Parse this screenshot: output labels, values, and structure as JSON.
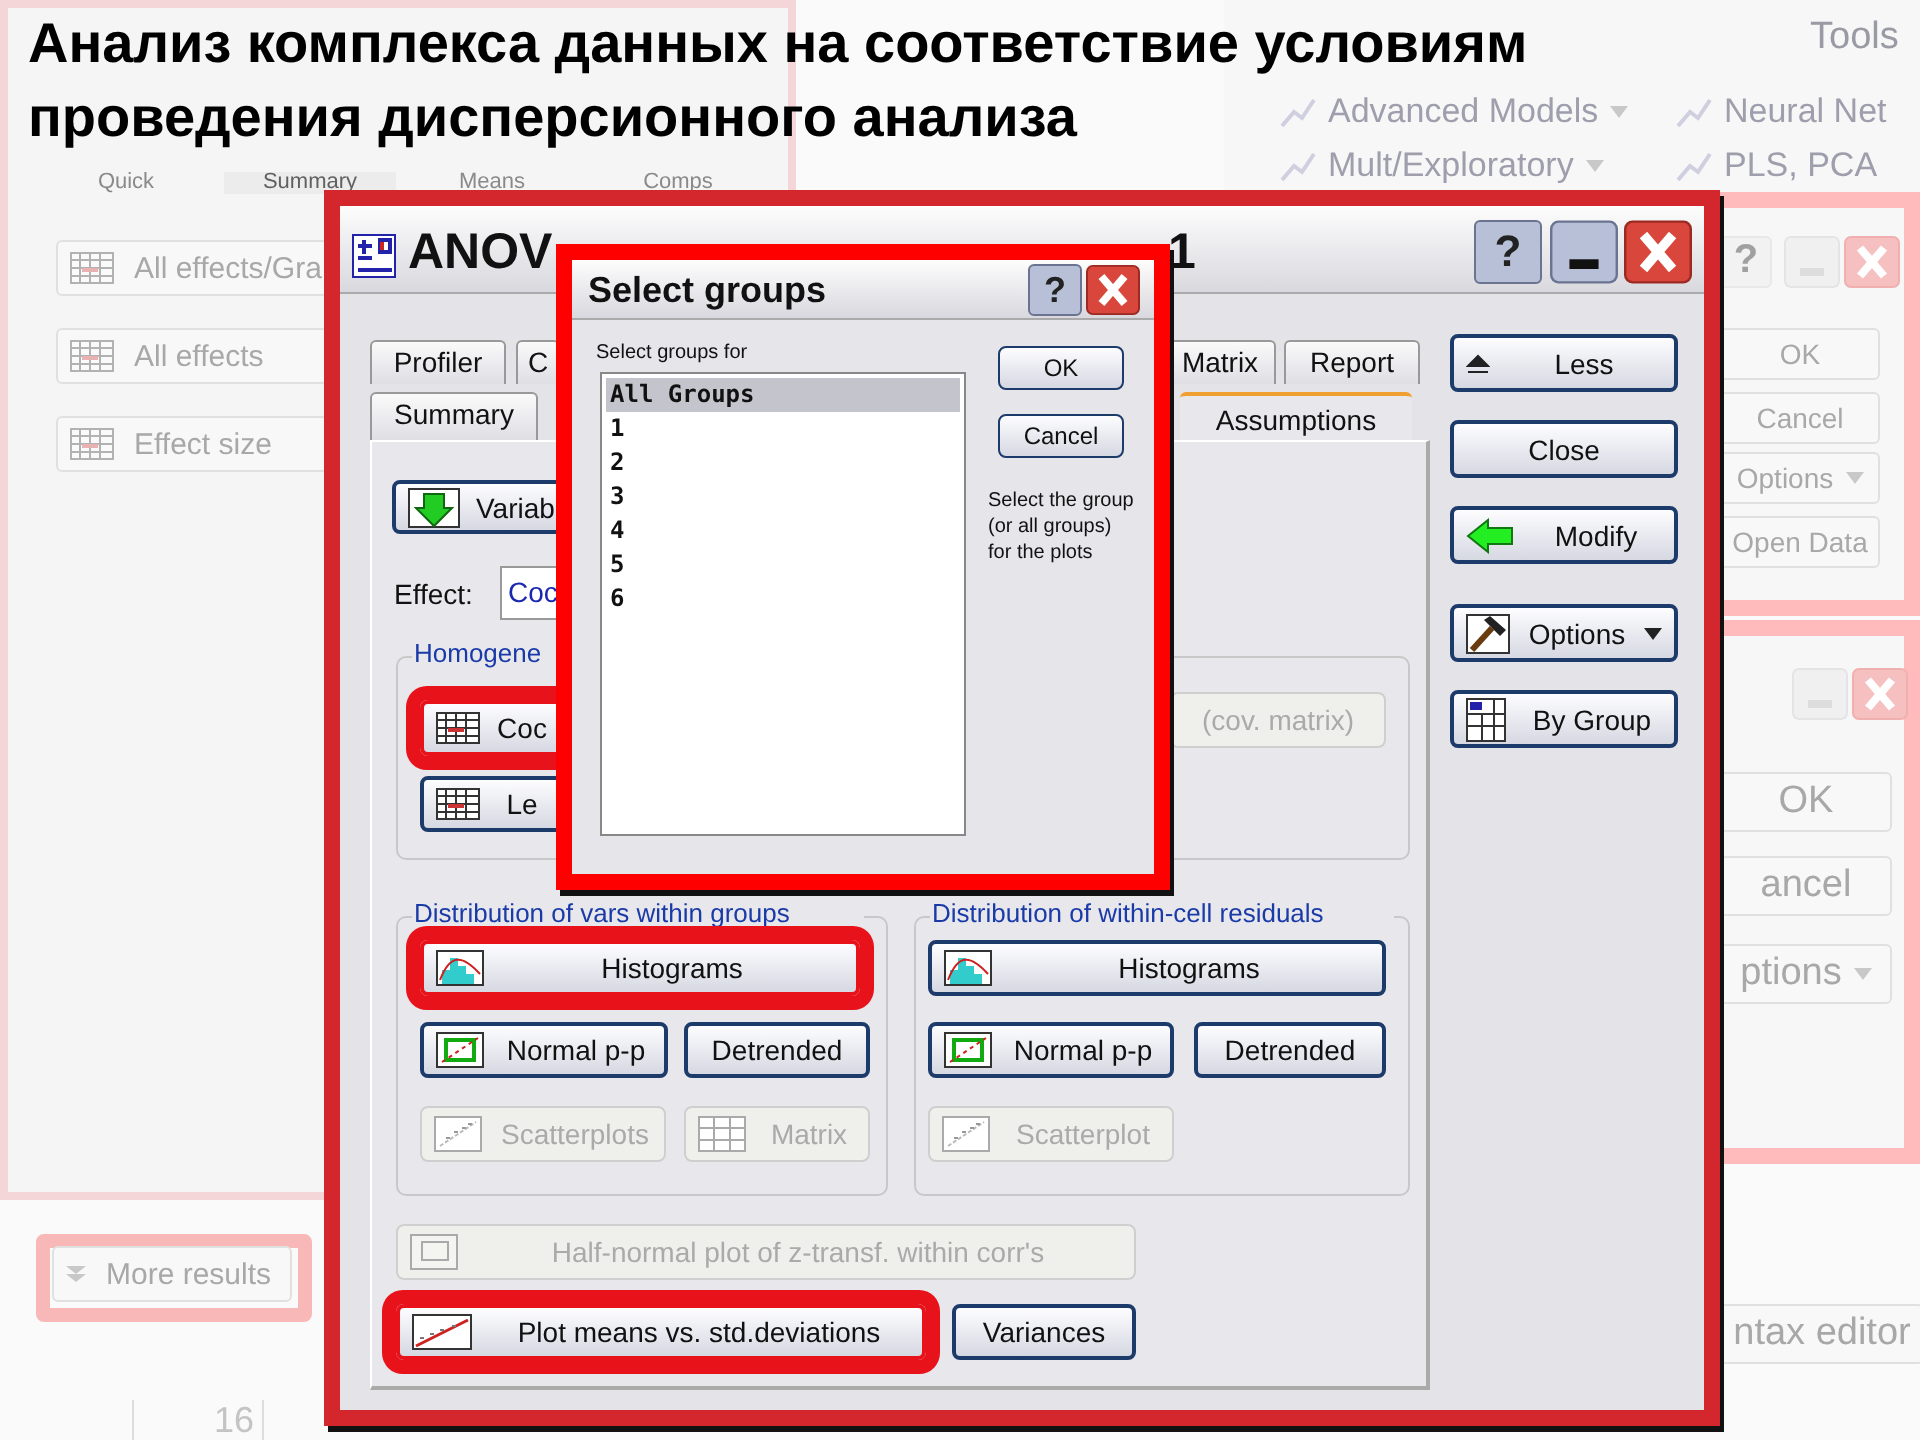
{
  "slide_title": [
    "Анализ комплекса данных на соответствие условиям",
    "проведения дисперсионного анализа"
  ],
  "background_left_window": {
    "tabs": [
      {
        "label": "Quick",
        "selected": false
      },
      {
        "label": "Summary",
        "selected": true
      },
      {
        "label": "Means",
        "selected": false
      },
      {
        "label": "Comps",
        "selected": false
      }
    ],
    "buttons": [
      "All effects/Gra",
      "All effects",
      "Effect size"
    ],
    "more_results": "More results",
    "row_number": "16"
  },
  "background_ribbon": {
    "tab": "Tools",
    "items": [
      {
        "label": "Advanced Models",
        "dropdown": true
      },
      {
        "label": "Neural Net",
        "dropdown": false
      },
      {
        "label": "Mult/Exploratory",
        "dropdown": true
      },
      {
        "label": "PLS, PCA",
        "dropdown": false
      }
    ]
  },
  "background_right_window_1": {
    "help": "?",
    "buttons": [
      "OK",
      "Cancel",
      "Options",
      "Open Data"
    ]
  },
  "background_right_window_2": {
    "buttons": [
      "OK",
      "ancel",
      "ptions",
      "ntax editor"
    ]
  },
  "anova_window": {
    "title_start": "ANOV",
    "title_end": "1",
    "help": "?",
    "tabs_row_1": [
      {
        "label": "Profiler",
        "selected": false
      },
      {
        "label": "C",
        "selected": false
      },
      {
        "label": "Matrix",
        "selected": false
      },
      {
        "label": "Report",
        "selected": false
      }
    ],
    "tabs_row_2": [
      {
        "label": "Summary",
        "selected": false
      },
      {
        "label": "Assumptions",
        "selected": true
      }
    ],
    "variables_button": "Variab",
    "effect_label": "Effect:",
    "effect_value": "Coc",
    "homogeneity": {
      "label": "Homogene",
      "buttons": [
        {
          "label": "Coc",
          "disabled": false,
          "highlighted": true
        },
        {
          "label": "Le",
          "disabled": false,
          "highlighted": false
        },
        {
          "label": "(cov. matrix)",
          "disabled": true,
          "highlighted": false
        }
      ]
    },
    "vars_within_groups": {
      "label": "Distribution of vars within groups",
      "buttons": [
        {
          "label": "Histograms",
          "disabled": false,
          "highlighted": true
        },
        {
          "label": "Normal p-p",
          "disabled": false,
          "highlighted": false
        },
        {
          "label": "Detrended",
          "disabled": false,
          "highlighted": false
        },
        {
          "label": "Scatterplots",
          "disabled": true,
          "highlighted": false
        },
        {
          "label": "Matrix",
          "disabled": true,
          "highlighted": false
        }
      ]
    },
    "within_cell_residuals": {
      "label": "Distribution of within-cell residuals",
      "buttons": [
        {
          "label": "Histograms",
          "disabled": false,
          "highlighted": false
        },
        {
          "label": "Normal p-p",
          "disabled": false,
          "highlighted": false
        },
        {
          "label": "Detrended",
          "disabled": false,
          "highlighted": false
        },
        {
          "label": "Scatterplot",
          "disabled": true,
          "highlighted": false
        }
      ]
    },
    "bottom_buttons": [
      {
        "label": "Half-normal plot of z-transf. within corr's",
        "disabled": true,
        "highlighted": false
      },
      {
        "label": "Plot means vs. std.deviations",
        "disabled": false,
        "highlighted": true
      },
      {
        "label": "Variances",
        "disabled": false,
        "highlighted": false
      }
    ],
    "side_buttons": [
      {
        "label": "Less",
        "dropdown": false
      },
      {
        "label": "Close",
        "dropdown": false
      },
      {
        "label": "Modify",
        "dropdown": false
      },
      {
        "label": "Options",
        "dropdown": true
      },
      {
        "label": "By Group",
        "dropdown": false
      }
    ]
  },
  "select_groups_dialog": {
    "title": "Select groups",
    "help": "?",
    "list_label": "Select groups for",
    "groups": [
      {
        "label": "All Groups",
        "selected": true
      },
      {
        "label": "1",
        "selected": false
      },
      {
        "label": "2",
        "selected": false
      },
      {
        "label": "3",
        "selected": false
      },
      {
        "label": "4",
        "selected": false
      },
      {
        "label": "5",
        "selected": false
      },
      {
        "label": "6",
        "selected": false
      }
    ],
    "buttons": [
      "OK",
      "Cancel"
    ],
    "hint": "Select the group (or all groups) for the plots"
  }
}
